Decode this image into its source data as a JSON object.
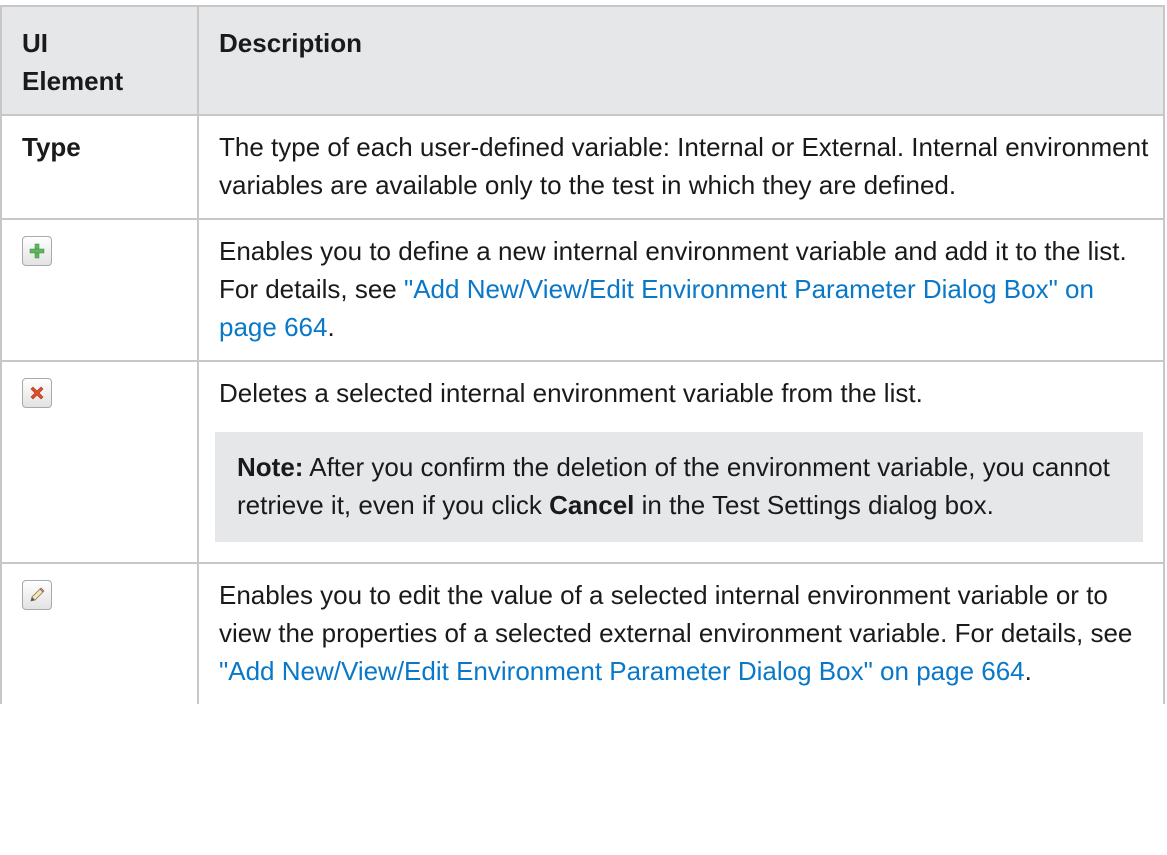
{
  "header": {
    "col1": "UI Element",
    "col1_line1": "UI",
    "col1_line2": "Element",
    "col2": "Description"
  },
  "rows": [
    {
      "element": "Type",
      "description": "The type of each user-defined variable: Internal or External. Internal environment variables are available only to the test in which they are defined."
    },
    {
      "element_icon": "add-icon",
      "description_before": "Enables you to define a new internal environment variable and add it to the list. For details, see ",
      "link": "\"Add New/View/Edit Environment Parameter Dialog Box\" on page 664",
      "description_after": "."
    },
    {
      "element_icon": "delete-icon",
      "description": "Deletes a selected internal environment variable from the list.",
      "note_label": "Note:",
      "note_text_1": " After you confirm the deletion of the environment variable, you cannot retrieve it, even if you click ",
      "note_bold": "Cancel",
      "note_text_2": " in the Test Settings dialog box."
    },
    {
      "element_icon": "edit-icon",
      "description_before": "Enables you to edit the value of a selected internal environment variable or to view the properties of a selected external environment variable. For details, see ",
      "link": "\"Add New/View/Edit Environment Parameter Dialog Box\" on page 664",
      "description_after": "."
    }
  ],
  "colors": {
    "header_bg": "#e6e7e8",
    "border": "#c7c7c7",
    "link": "#0a78c8",
    "note_bg": "#e6e7e8",
    "add_icon": "#5cb85c",
    "delete_icon": "#e0502a"
  }
}
